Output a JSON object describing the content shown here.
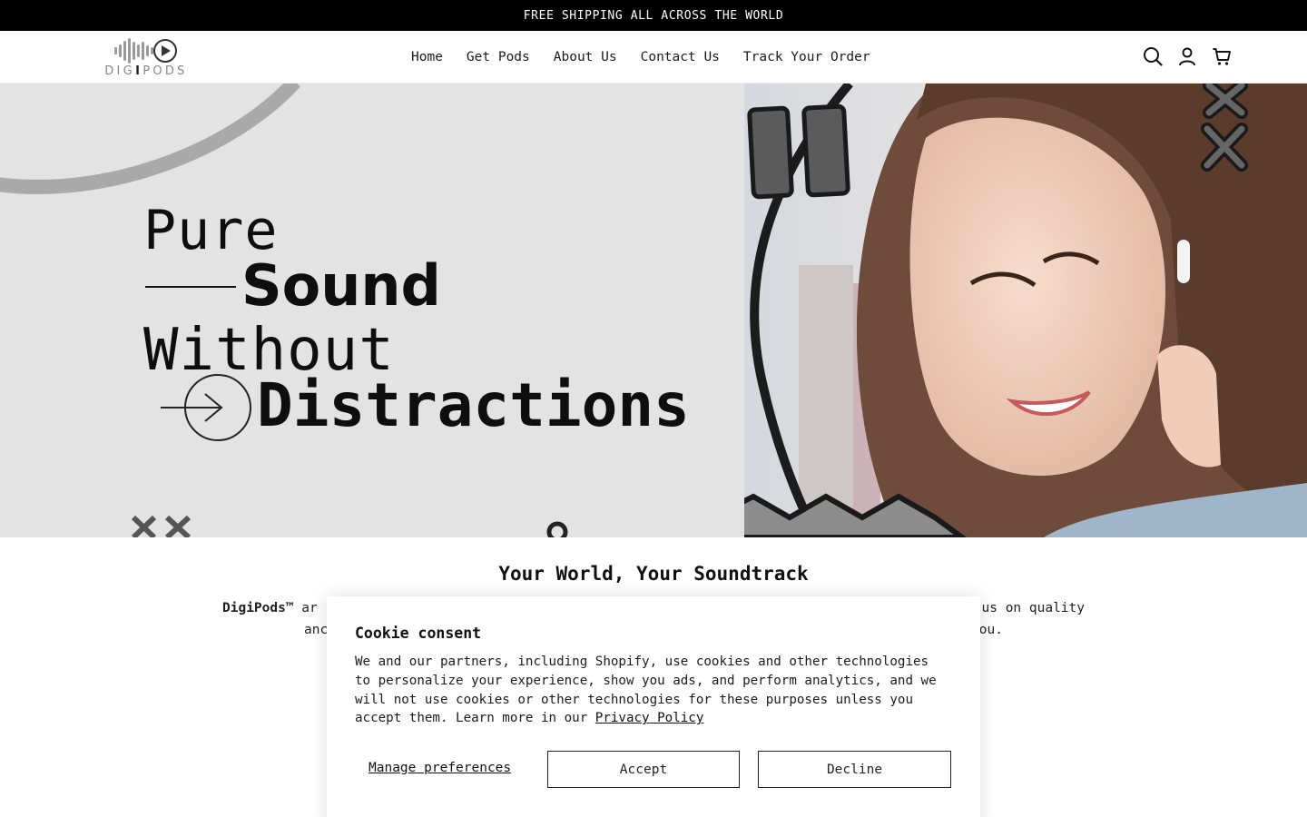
{
  "announcement": "FREE SHIPPING ALL ACROSS THE WORLD",
  "logo": {
    "text_pre": "DIG",
    "text_mid": "I",
    "text_post": "PODS"
  },
  "nav": [
    {
      "label": "Home"
    },
    {
      "label": "Get Pods"
    },
    {
      "label": "About Us"
    },
    {
      "label": "Contact Us"
    },
    {
      "label": "Track Your Order"
    }
  ],
  "header_icons": [
    "search-icon",
    "account-icon",
    "cart-icon"
  ],
  "hero": {
    "line1": "Pure",
    "line2": "Sound",
    "line3": "Without",
    "line4": "Distractions"
  },
  "intro": {
    "title": "Your World, Your Soundtrack",
    "brand": "DigiPods™",
    "line1_tail": " ar",
    "line1_end": "us on quality",
    "line2_start": "anc",
    "line2_end": "ou."
  },
  "cookie": {
    "title": "Cookie consent",
    "text": "We and our partners, including Shopify, use cookies and other technologies to personalize your experience, show you ads, and perform analytics, and we will not use cookies or other technologies for these purposes unless you accept them. Learn more in our ",
    "link": "Privacy Policy",
    "manage": "Manage preferences",
    "accept": "Accept",
    "decline": "Decline"
  },
  "colors": {
    "announcement_bg": "#000000",
    "hero_bg": "#e3e3e3",
    "text": "#121212"
  }
}
